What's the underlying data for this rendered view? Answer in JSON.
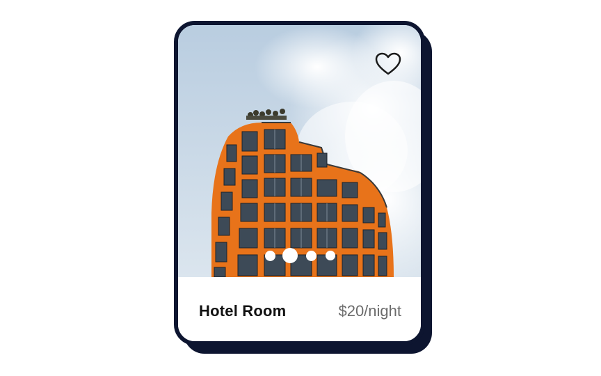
{
  "listing": {
    "title": "Hotel Room",
    "price": "$20/night",
    "favorite_icon": "heart-outline-icon",
    "carousel": {
      "count": 4,
      "active_index": 1
    }
  },
  "colors": {
    "card_border": "#0d1530",
    "building_facade": "#e8731a",
    "sky": "#cbd9e6",
    "price_text": "#6b6b6b"
  }
}
